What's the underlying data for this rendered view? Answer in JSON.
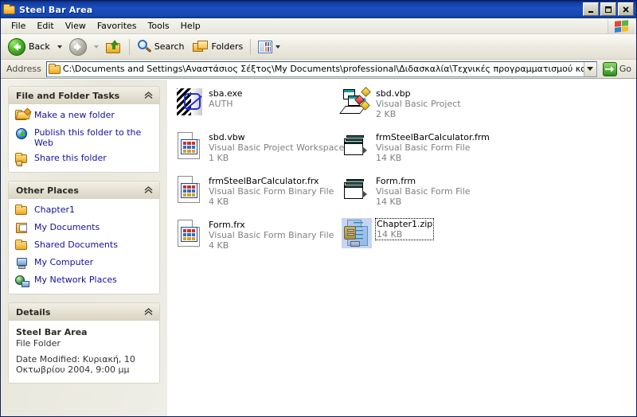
{
  "window": {
    "title": "Steel Bar Area",
    "controls": {
      "minimize": "_",
      "maximize": "□",
      "close": "✕"
    }
  },
  "menu": {
    "items": [
      "File",
      "Edit",
      "View",
      "Favorites",
      "Tools",
      "Help"
    ]
  },
  "toolbar": {
    "back_label": "Back",
    "forward_label": "",
    "up_label": "",
    "search_label": "Search",
    "folders_label": "Folders",
    "views_label": ""
  },
  "address": {
    "label": "Address",
    "value": "C:\\Documents and Settings\\Αναστάσιος Σέξτος\\My Documents\\professional\\Διδασκαλία\\Τεχνικές προγραμματισμού και χρήση λογισμικ",
    "go_label": "Go"
  },
  "taskpane": {
    "file_tasks": {
      "title": "File and Folder Tasks",
      "items": [
        {
          "label": "Make a new folder",
          "icon": "new-folder-icon"
        },
        {
          "label": "Publish this folder to the Web",
          "icon": "publish-web-icon"
        },
        {
          "label": "Share this folder",
          "icon": "share-folder-icon"
        }
      ]
    },
    "other_places": {
      "title": "Other Places",
      "items": [
        {
          "label": "Chapter1",
          "icon": "folder-icon"
        },
        {
          "label": "My Documents",
          "icon": "my-documents-icon"
        },
        {
          "label": "Shared Documents",
          "icon": "shared-documents-icon"
        },
        {
          "label": "My Computer",
          "icon": "my-computer-icon"
        },
        {
          "label": "My Network Places",
          "icon": "my-network-places-icon"
        }
      ]
    },
    "details": {
      "title": "Details",
      "name": "Steel Bar Area",
      "type": "File Folder",
      "date_modified": "Date Modified: Κυριακή, 10 Οκτωβρίου 2004, 9:00 μμ"
    }
  },
  "files": [
    {
      "name": "sba.exe",
      "type": "AUTH",
      "size": "",
      "icon": "exe-icon",
      "selected": false
    },
    {
      "name": "sbd.vbp",
      "type": "Visual Basic Project",
      "size": "2 KB",
      "icon": "vbp-icon",
      "selected": false
    },
    {
      "name": "sbd.vbw",
      "type": "Visual Basic Project Workspace",
      "size": "1 KB",
      "icon": "vbfile-icon",
      "selected": false
    },
    {
      "name": "frmSteelBarCalculator.frm",
      "type": "Visual Basic Form File",
      "size": "14 KB",
      "icon": "frm-icon",
      "selected": false
    },
    {
      "name": "frmSteelBarCalculator.frx",
      "type": "Visual Basic Form Binary File",
      "size": "4 KB",
      "icon": "vbfile-icon",
      "selected": false
    },
    {
      "name": "Form.frm",
      "type": "Visual Basic Form File",
      "size": "14 KB",
      "icon": "frm-icon",
      "selected": false
    },
    {
      "name": "Form.frx",
      "type": "Visual Basic Form Binary File",
      "size": "4 KB",
      "icon": "vbfile-icon",
      "selected": false
    },
    {
      "name": "Chapter1.zip",
      "type": "",
      "size": "14 KB",
      "icon": "zip-icon",
      "selected": true
    }
  ],
  "colors": {
    "titlebar": "#1347ae",
    "accent_link": "#11119e",
    "panel_header": "#e6e2d4",
    "meta_text": "#808080"
  }
}
